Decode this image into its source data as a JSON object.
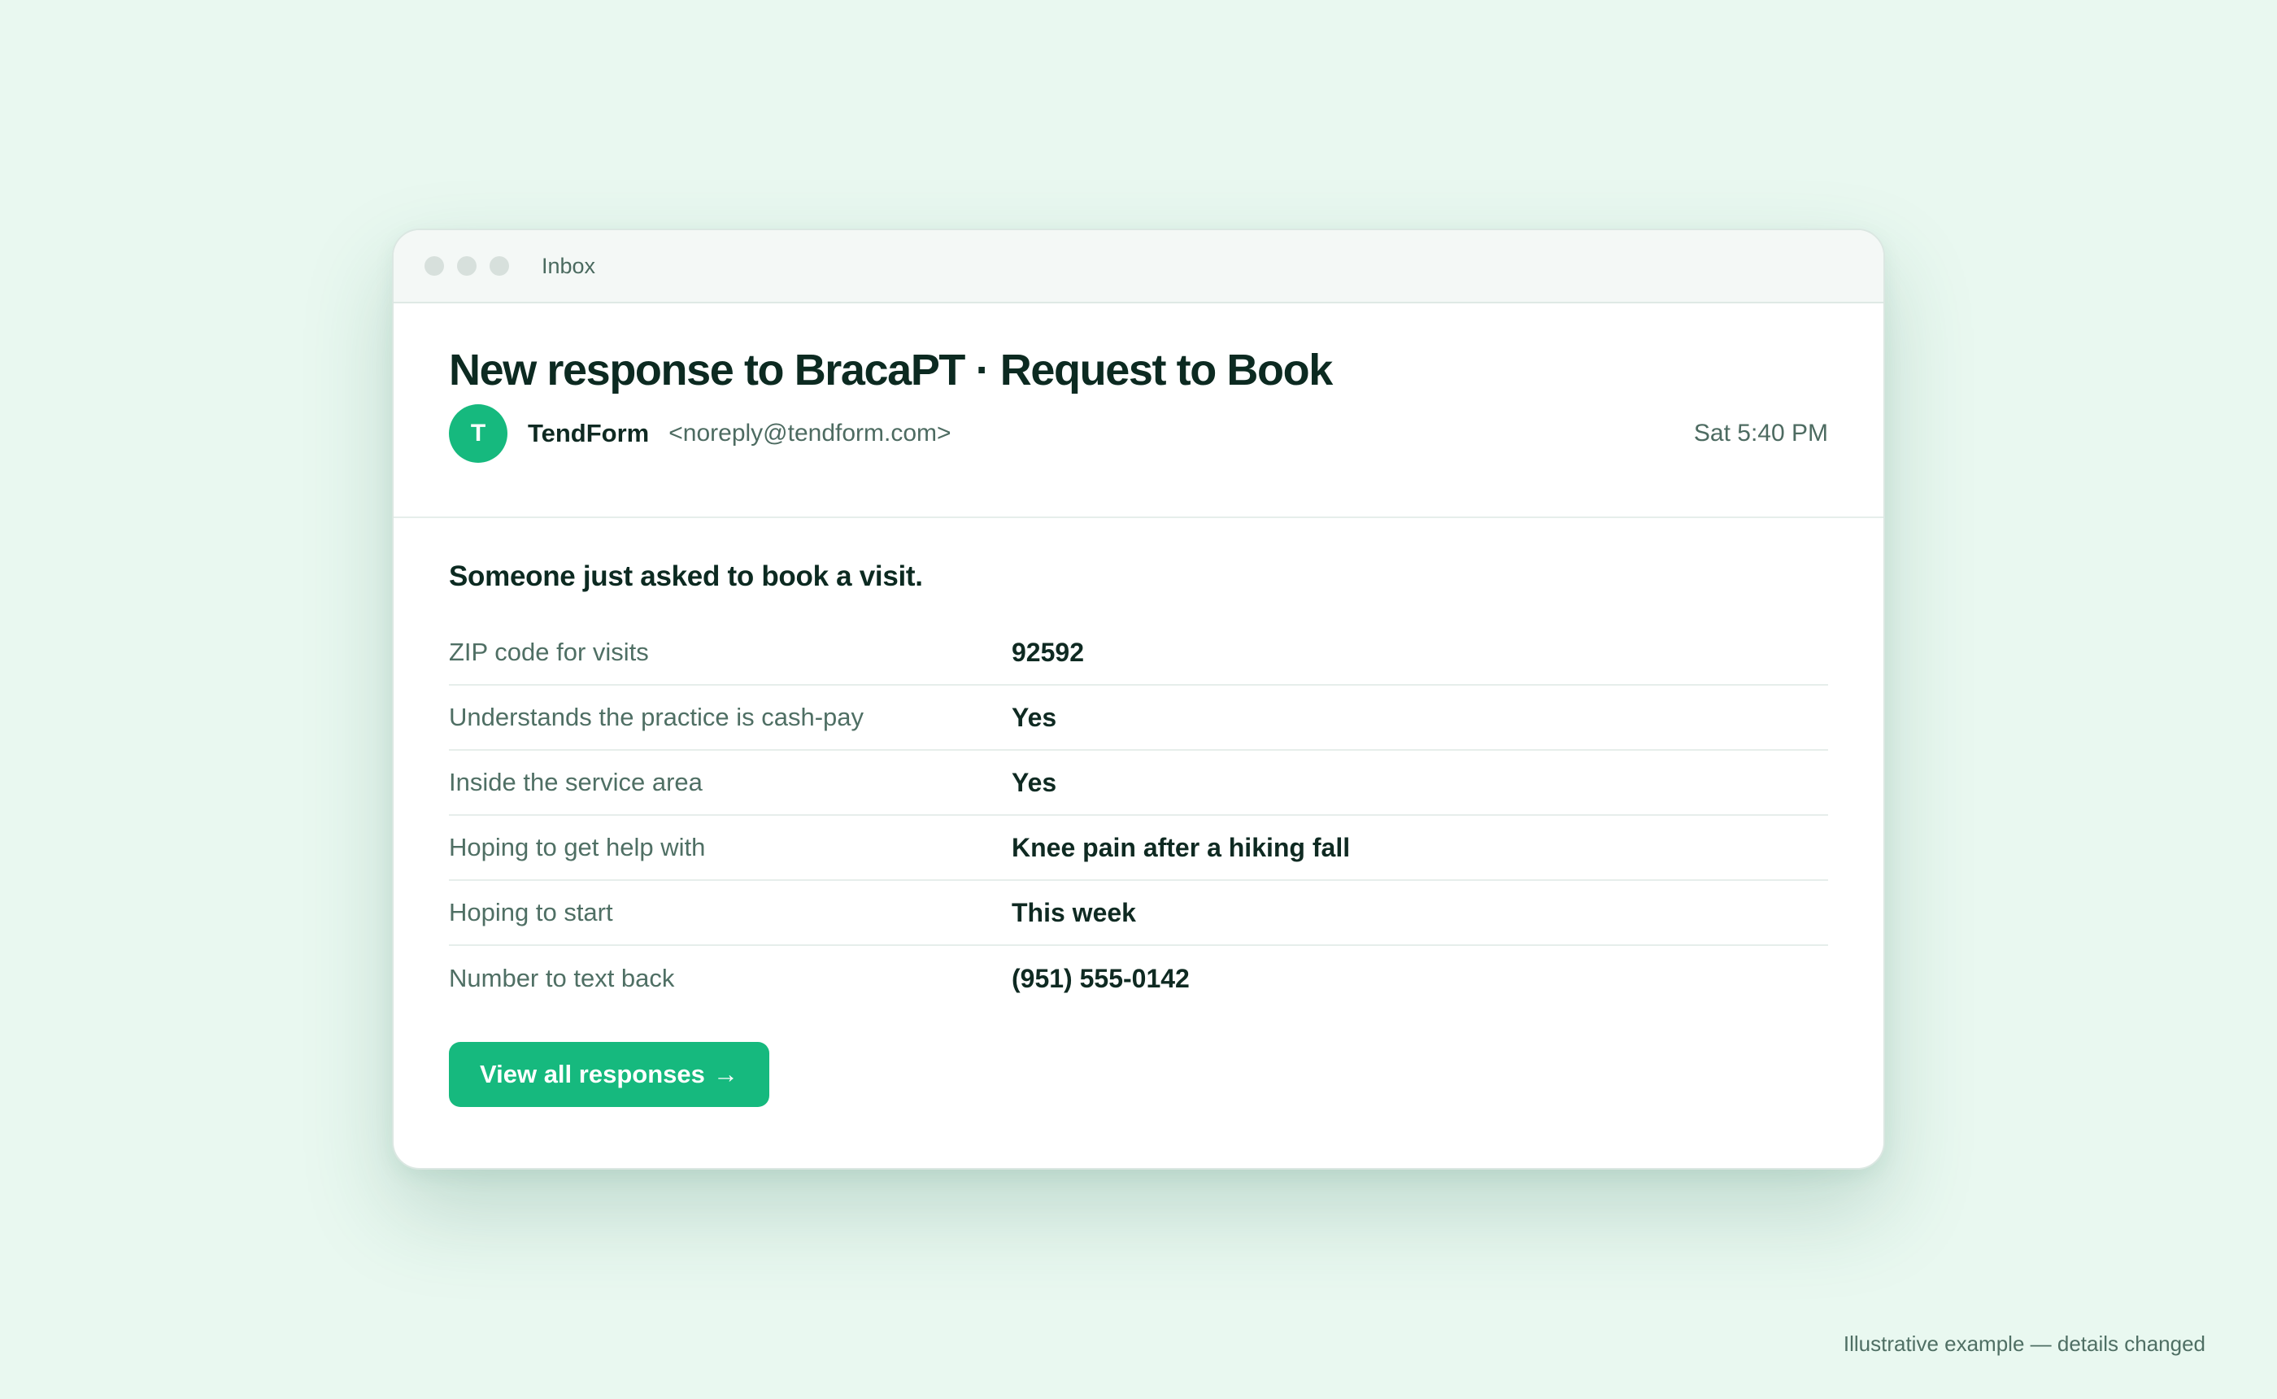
{
  "window": {
    "title": "Inbox"
  },
  "email": {
    "subject": "New response to BracaPT · Request to Book",
    "sender": {
      "avatar_initial": "T",
      "name": "TendForm",
      "address": "<noreply@tendform.com>"
    },
    "timestamp": "Sat 5:40 PM",
    "lead": "Someone just asked to book a visit.",
    "fields": [
      {
        "label": "ZIP code for visits",
        "value": "92592"
      },
      {
        "label": "Understands the practice is cash-pay",
        "value": "Yes"
      },
      {
        "label": "Inside the service area",
        "value": "Yes"
      },
      {
        "label": "Hoping to get help with",
        "value": "Knee pain after a hiking fall"
      },
      {
        "label": "Hoping to start",
        "value": "This week"
      },
      {
        "label": "Number to text back",
        "value": "(951) 555-0142"
      }
    ],
    "cta": {
      "label": "View all responses",
      "arrow": "→"
    }
  },
  "footnote": "Illustrative example — details changed",
  "colors": {
    "page_background": "#e9f8f0",
    "accent": "#16b97e",
    "text_primary": "#0c2a21",
    "text_secondary": "#4d6b61"
  },
  "icons": {
    "window_controls": [
      "window-dot-icon",
      "window-dot-icon",
      "window-dot-icon"
    ],
    "cta_arrow": "arrow-right-icon"
  }
}
